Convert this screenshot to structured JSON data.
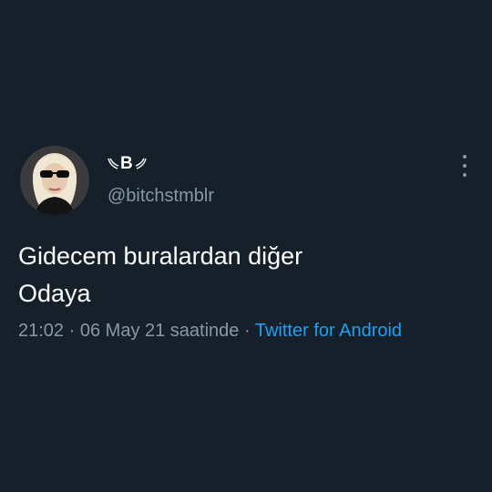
{
  "tweet": {
    "author": {
      "display_name": "B",
      "handle": "@bitchstmblr"
    },
    "text_lines": [
      "Gidecem buralardan diğer",
      "Odaya"
    ],
    "time": "21:02",
    "date": "06 May 21 saatinde",
    "separator": "·",
    "source": "Twitter for Android"
  },
  "icons": {
    "menu": "more-vertical-icon",
    "wings": "wing-icon"
  },
  "colors": {
    "background": "#15202b",
    "text": "#ffffff",
    "secondary": "#8899a6",
    "link": "#1da1f2"
  }
}
